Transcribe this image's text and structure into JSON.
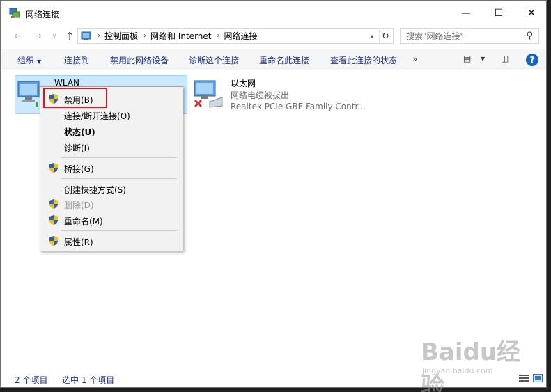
{
  "window": {
    "title": "网络连接"
  },
  "controls": {
    "minimize": "—",
    "maximize": "☐",
    "close": "✕"
  },
  "nav": {
    "back": "←",
    "forward": "→",
    "recent": "∨",
    "up": "↑"
  },
  "address": {
    "crumbs": [
      "控制面板",
      "网络和 Internet",
      "网络连接"
    ],
    "separator": "›",
    "dropdown": "∨",
    "refresh": "↻"
  },
  "search": {
    "placeholder": "搜索\"网络连接\"",
    "icon": "⚲"
  },
  "toolbar": {
    "organize": "组织",
    "caret": "▼",
    "connect_to": "连接到",
    "disable_device": "禁用此网络设备",
    "diagnose": "诊断这个连接",
    "rename": "重命名此连接",
    "view_status": "查看此连接的状态",
    "more": "»",
    "view_icon": "▤",
    "view_caret": "▼",
    "pane_icon": "◫",
    "help": "?"
  },
  "connections": [
    {
      "name": "WLAN",
      "status": "",
      "adapter": ""
    },
    {
      "name": "以太网",
      "status": "网络电缆被拔出",
      "adapter": "Realtek PCIe GBE Family Contr..."
    }
  ],
  "context_menu": {
    "items": [
      {
        "label": "禁用(B)",
        "icon": "shield-icon"
      },
      {
        "label": "连接/断开连接(O)"
      },
      {
        "label": "状态(U)",
        "bold": true
      },
      {
        "label": "诊断(I)"
      },
      {
        "label": "桥接(G)",
        "icon": "shield-icon"
      },
      {
        "label": "创建快捷方式(S)"
      },
      {
        "label": "删除(D)",
        "icon": "shield-icon",
        "disabled": true
      },
      {
        "label": "重命名(M)",
        "icon": "shield-icon"
      },
      {
        "label": "属性(R)",
        "icon": "shield-icon"
      }
    ]
  },
  "status_bar": {
    "item_count": "2 个项目",
    "selected": "选中 1 个项目"
  },
  "watermark": {
    "logo": "Baidu经验",
    "url": "jingyan.baidu.com"
  },
  "colors": {
    "selection_bg": "#cce8ff",
    "link_text": "#1e3287",
    "highlight_border": "#e0141e"
  }
}
